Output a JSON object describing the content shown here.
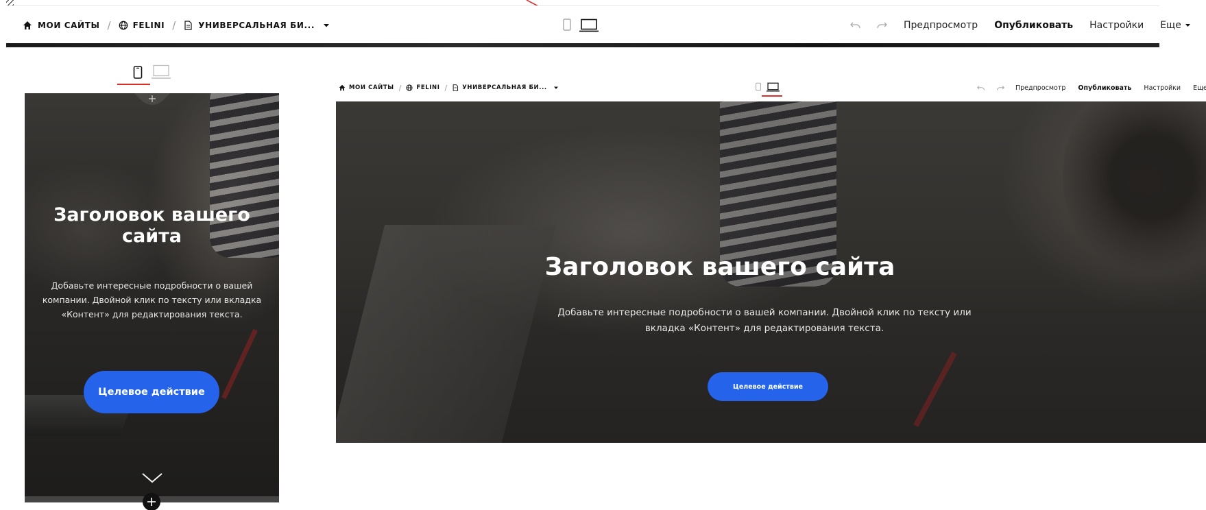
{
  "toolbar": {
    "breadcrumbs": [
      {
        "label": "МОИ САЙТЫ",
        "icon": "home-icon"
      },
      {
        "label": "FELINI",
        "icon": "globe-icon"
      },
      {
        "label": "УНИВЕРСАЛЬНАЯ БИ...",
        "icon": "page-icon"
      }
    ],
    "separator": "/",
    "preview_label": "Предпросмотр",
    "publish_label": "Опубликовать",
    "settings_label": "Настройки",
    "more_label": "Еще",
    "device_modes": [
      "mobile",
      "desktop"
    ]
  },
  "hero": {
    "title": "Заголовок вашего сайта",
    "description": "Добавьте интересные подробности о вашей компании. Двойной клик по тексту или вкладка «Контент» для редактирования текста.",
    "cta_label": "Целевое действие"
  },
  "colors": {
    "accent": "#2563eb",
    "annotation": "#d9302c"
  }
}
